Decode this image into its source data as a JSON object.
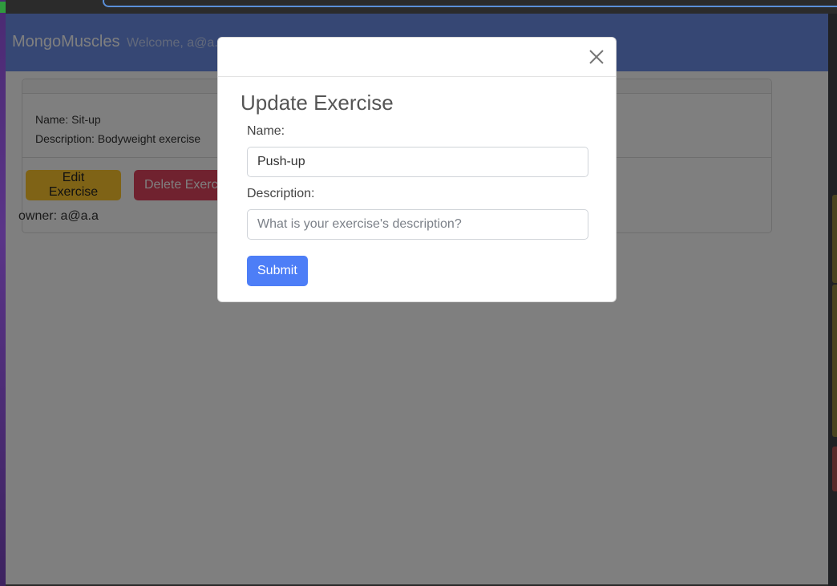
{
  "navbar": {
    "brand": "MongoMuscles",
    "welcome": "Welcome, a@a.a"
  },
  "exercise_card": {
    "name_line": "Name: Sit-up",
    "description_line": "Description: Bodyweight exercise",
    "edit_label": "Edit Exercise",
    "delete_label": "Delete Exercise",
    "owner_line": "owner: a@a.a"
  },
  "modal": {
    "title": "Update Exercise",
    "name_label": "Name:",
    "name_value": "Push-up",
    "description_label": "Description:",
    "description_placeholder": "What is your exercise's description?",
    "submit_label": "Submit",
    "close_icon": "close-icon"
  },
  "colors": {
    "navbar": "#6c8fe8",
    "edit_button": "#ffc72c",
    "delete_button": "#e0455f",
    "submit_button": "#4d7ef7"
  }
}
